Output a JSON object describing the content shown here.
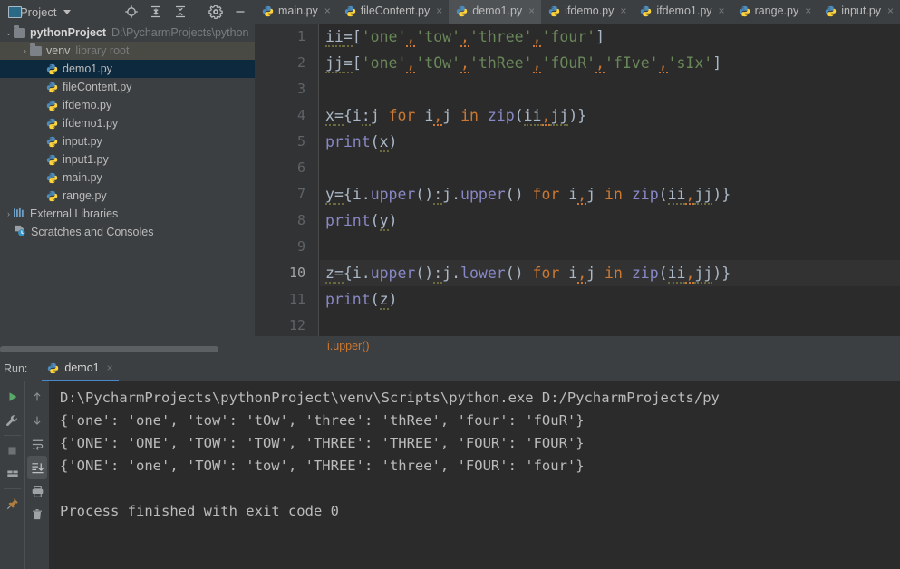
{
  "window": {
    "project_label": "Project",
    "toolbar_icons": [
      "locate-target-icon",
      "expand-all-icon",
      "collapse-all-icon",
      "settings-gear-icon",
      "minimize-icon"
    ]
  },
  "tabs": [
    {
      "label": "main.py",
      "active": false,
      "icon": "python-file-icon",
      "close": "×"
    },
    {
      "label": "fileContent.py",
      "active": false,
      "icon": "python-file-icon",
      "close": "×"
    },
    {
      "label": "demo1.py",
      "active": true,
      "icon": "python-file-icon",
      "close": "×"
    },
    {
      "label": "ifdemo.py",
      "active": false,
      "icon": "python-file-icon",
      "close": "×"
    },
    {
      "label": "ifdemo1.py",
      "active": false,
      "icon": "python-file-icon",
      "close": "×"
    },
    {
      "label": "range.py",
      "active": false,
      "icon": "python-file-icon",
      "close": "×"
    },
    {
      "label": "input.py",
      "active": false,
      "icon": "python-file-icon",
      "close": "×"
    }
  ],
  "tree": [
    {
      "label": "pythonProject",
      "hint": "D:\\PycharmProjects\\python",
      "indent": 0,
      "arrow": "⌄",
      "kind": "folder",
      "state": "normal",
      "bold": true
    },
    {
      "label": "venv",
      "hint": "library root",
      "indent": 1,
      "arrow": "›",
      "kind": "folder",
      "state": "hover",
      "bold": false
    },
    {
      "label": "demo1.py",
      "hint": "",
      "indent": 2,
      "arrow": "",
      "kind": "python",
      "state": "selected",
      "bold": false
    },
    {
      "label": "fileContent.py",
      "hint": "",
      "indent": 2,
      "arrow": "",
      "kind": "python",
      "state": "normal",
      "bold": false
    },
    {
      "label": "ifdemo.py",
      "hint": "",
      "indent": 2,
      "arrow": "",
      "kind": "python",
      "state": "normal",
      "bold": false
    },
    {
      "label": "ifdemo1.py",
      "hint": "",
      "indent": 2,
      "arrow": "",
      "kind": "python",
      "state": "normal",
      "bold": false
    },
    {
      "label": "input.py",
      "hint": "",
      "indent": 2,
      "arrow": "",
      "kind": "python",
      "state": "normal",
      "bold": false
    },
    {
      "label": "input1.py",
      "hint": "",
      "indent": 2,
      "arrow": "",
      "kind": "python",
      "state": "normal",
      "bold": false
    },
    {
      "label": "main.py",
      "hint": "",
      "indent": 2,
      "arrow": "",
      "kind": "python",
      "state": "normal",
      "bold": false
    },
    {
      "label": "range.py",
      "hint": "",
      "indent": 2,
      "arrow": "",
      "kind": "python",
      "state": "normal",
      "bold": false
    },
    {
      "label": "External Libraries",
      "hint": "",
      "indent": 0,
      "arrow": "›",
      "kind": "library",
      "state": "normal",
      "bold": false
    },
    {
      "label": "Scratches and Consoles",
      "hint": "",
      "indent": 0,
      "arrow": "",
      "kind": "scratch",
      "state": "normal",
      "bold": false
    }
  ],
  "editor": {
    "line_numbers": [
      "1",
      "2",
      "3",
      "4",
      "5",
      "6",
      "7",
      "8",
      "9",
      "10",
      "11",
      "12"
    ],
    "current_line": 10,
    "lines": [
      "ii=['one','tow','three','four']",
      "jj=['one','tOw','thRee','fOuR','fIve','sIx']",
      "",
      "x={i:j for i,j in zip(ii,jj)}",
      "print(x)",
      "",
      "y={i.upper():j.upper() for i,j in zip(ii,jj)}",
      "print(y)",
      "",
      "z={i.upper():j.lower() for i,j in zip(ii,jj)}",
      "print(z)",
      ""
    ],
    "breadcrumb": "i.upper()"
  },
  "run": {
    "label": "Run:",
    "tab_label": "demo1",
    "tab_close": "×",
    "left_tools": [
      "run-icon",
      "debug-wrench-icon",
      "stop-icon",
      "layout-icon",
      "pin-icon"
    ],
    "right_tools": [
      "scroll-up-icon",
      "scroll-down-icon",
      "soft-wrap-icon",
      "scroll-to-end-icon",
      "print-icon",
      "trash-icon"
    ],
    "console_lines": [
      "D:\\PycharmProjects\\pythonProject\\venv\\Scripts\\python.exe D:/PycharmProjects/py",
      "{'one': 'one', 'tow': 'tOw', 'three': 'thRee', 'four': 'fOuR'}",
      "{'ONE': 'ONE', 'TOW': 'TOW', 'THREE': 'THREE', 'FOUR': 'FOUR'}",
      "{'ONE': 'one', 'TOW': 'tow', 'THREE': 'three', 'FOUR': 'four'}",
      "",
      "Process finished with exit code 0"
    ]
  },
  "colors": {
    "bg_chrome": "#3c3f41",
    "bg_editor": "#2b2b2b",
    "accent_blue": "#4a88c7",
    "selection": "#0d293e",
    "string_green": "#6a8759",
    "keyword_orange": "#cc7832",
    "function_purple": "#8888c6",
    "identifier": "#a9b7c6",
    "match_highlight": "#3b514d"
  }
}
